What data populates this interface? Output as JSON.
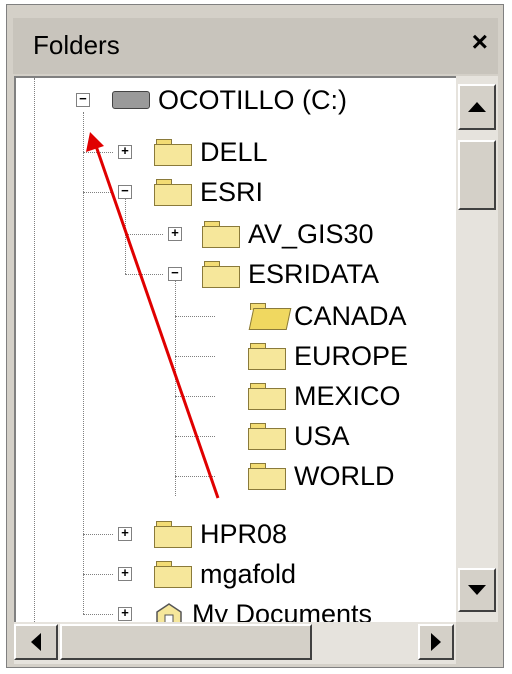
{
  "panel": {
    "title": "Folders",
    "close_glyph": "×"
  },
  "tree": {
    "items": [
      {
        "label": "OCOTILLO (C:)",
        "icon": "drive-icon",
        "expander": "−"
      },
      {
        "label": "DELL",
        "icon": "folder-icon",
        "expander": "+"
      },
      {
        "label": "ESRI",
        "icon": "folder-icon",
        "expander": "−"
      },
      {
        "label": "AV_GIS30",
        "icon": "folder-icon",
        "expander": "+"
      },
      {
        "label": "ESRIDATA",
        "icon": "folder-icon",
        "expander": "−"
      },
      {
        "label": "CANADA",
        "icon": "open-folder-icon"
      },
      {
        "label": "EUROPE",
        "icon": "folder-icon"
      },
      {
        "label": "MEXICO",
        "icon": "folder-icon"
      },
      {
        "label": "USA",
        "icon": "folder-icon"
      },
      {
        "label": "WORLD",
        "icon": "folder-icon"
      },
      {
        "label": "HPR08",
        "icon": "folder-icon",
        "expander": "+"
      },
      {
        "label": "mgafold",
        "icon": "folder-icon",
        "expander": "+"
      },
      {
        "label": "My Documents",
        "icon": "documents-icon",
        "expander": "+"
      }
    ]
  },
  "annotation": {
    "arrow_color": "#e00000"
  }
}
